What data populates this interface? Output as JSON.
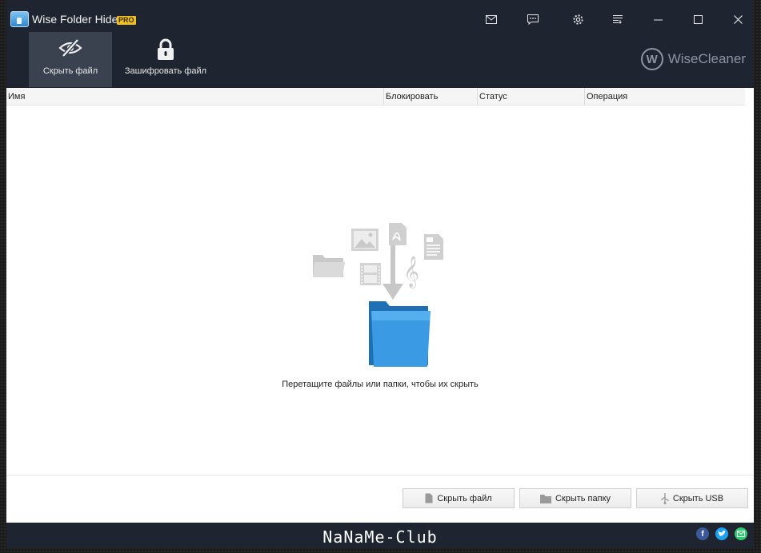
{
  "titlebar": {
    "app_name": "Wise Folder Hider",
    "badge": "PRO",
    "buttons": [
      "mail-icon",
      "feedback-icon",
      "settings-icon",
      "menu-icon",
      "minimize-icon",
      "maximize-icon",
      "close-icon"
    ]
  },
  "toolbar": {
    "hide_file_label": "Скрыть файл",
    "encrypt_file_label": "Зашифровать файл",
    "brand": "WiseCleaner",
    "brand_logo_letter": "W"
  },
  "list": {
    "columns": [
      "Имя",
      "Блокировать",
      "Статус",
      "Операция"
    ]
  },
  "empty_state": {
    "text": "Перетащите файлы или папки, чтобы их скрыть"
  },
  "actions": {
    "hide_file": "Скрыть файл",
    "hide_folder": "Скрыть папку",
    "hide_usb": "Скрыть USB"
  },
  "footer": {
    "watermark": "NaNaMe-Club"
  },
  "colors": {
    "window_bg": "#1f2530",
    "active_tab": "#3a4250",
    "folder_blue": "#2f8fd8",
    "facebook": "#3b5998",
    "twitter": "#1da1f2",
    "email": "#2ecc71"
  }
}
